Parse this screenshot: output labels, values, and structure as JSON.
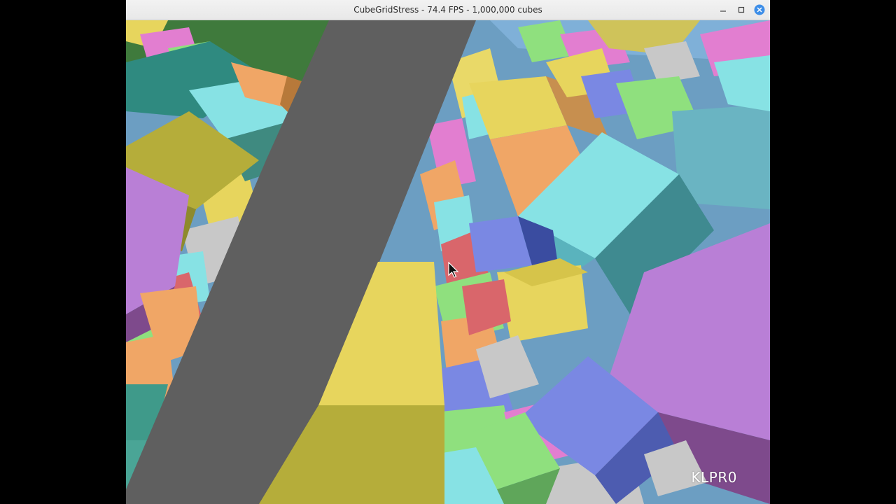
{
  "window": {
    "title": "CubeGridStress - 74.4 FPS - 1,000,000 cubes",
    "controls": [
      "minimize-icon",
      "maximize-icon",
      "close-icon"
    ],
    "close_color": "#3d8ee8"
  },
  "viewport": {
    "watermark": "KLPR0",
    "palette": [
      "#e7d55d",
      "#b97fd6",
      "#87e2e4",
      "#7a88e3",
      "#8fe07e",
      "#f0a666",
      "#d9666b",
      "#c8c8c8",
      "#5f5f5f"
    ]
  }
}
